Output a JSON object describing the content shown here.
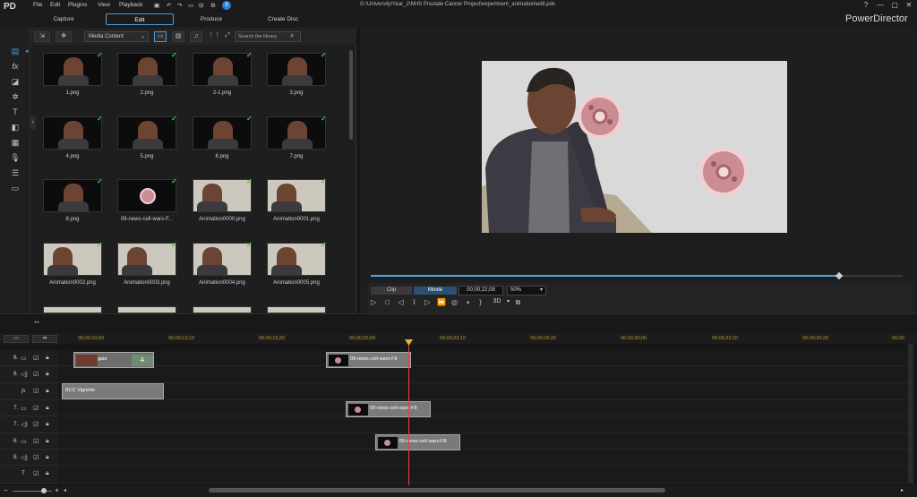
{
  "app": {
    "name": "PowerDirector",
    "logo": "PD"
  },
  "menu": [
    "File",
    "Edit",
    "Plugins",
    "View",
    "Playback"
  ],
  "file_path": "G:\\University\\Year_2\\NHS Prostate Cancer Project\\experiment_animation\\edit.pds",
  "tabs": [
    "Capture",
    "Edit",
    "Produce",
    "Create Disc"
  ],
  "library": {
    "dropdown": "Media Content",
    "search_placeholder": "Search the library",
    "items": [
      {
        "label": "1.png",
        "kind": "dark"
      },
      {
        "label": "2.png",
        "kind": "dark"
      },
      {
        "label": "2-1.png",
        "kind": "dark"
      },
      {
        "label": "3.png",
        "kind": "dark"
      },
      {
        "label": "4.png",
        "kind": "dark"
      },
      {
        "label": "5.png",
        "kind": "dark"
      },
      {
        "label": "6.png",
        "kind": "dark"
      },
      {
        "label": "7.png",
        "kind": "dark"
      },
      {
        "label": "8.png",
        "kind": "dark"
      },
      {
        "label": "09-news-cell-wars-F...",
        "kind": "cell"
      },
      {
        "label": "Animation0000.png",
        "kind": "light"
      },
      {
        "label": "Animation0001.png",
        "kind": "light"
      },
      {
        "label": "Animation0002.png",
        "kind": "light"
      },
      {
        "label": "Animation0003.png",
        "kind": "light"
      },
      {
        "label": "Animation0004.png",
        "kind": "light"
      },
      {
        "label": "Animation0005.png",
        "kind": "light"
      }
    ]
  },
  "preview": {
    "mode_clip": "Clip",
    "mode_movie": "Movie",
    "timecode": "00;00;22;08",
    "zoom": "50%",
    "three_d": "3D",
    "progress": 0.88
  },
  "timeline": {
    "ruler": [
      "00;00;10;00",
      "00;00;13;10",
      "00;00;16;20",
      "00;00;20;00",
      "00;00;23;10",
      "00;00;26;20",
      "00;00;30;00",
      "00;00;33;10",
      "00;00;36;20",
      "00;00"
    ],
    "tracks": [
      {
        "label": "6.",
        "icon": "video"
      },
      {
        "label": "6.",
        "icon": "audio"
      },
      {
        "label": "fx",
        "icon": "fx"
      },
      {
        "label": "7.",
        "icon": "video"
      },
      {
        "label": "7.",
        "icon": "audio"
      },
      {
        "label": "8.",
        "icon": "video"
      },
      {
        "label": "8.",
        "icon": "audio"
      },
      {
        "label": "T",
        "icon": "title"
      }
    ],
    "clips": {
      "gate": "gate",
      "gate_tag": "A",
      "cell1": "09-news-cell-wars-F8",
      "vignette": "BCC Vignette",
      "cell2": "09-news-cell-wars-F8",
      "cell3": "09-news-cell-wars-F8"
    }
  }
}
